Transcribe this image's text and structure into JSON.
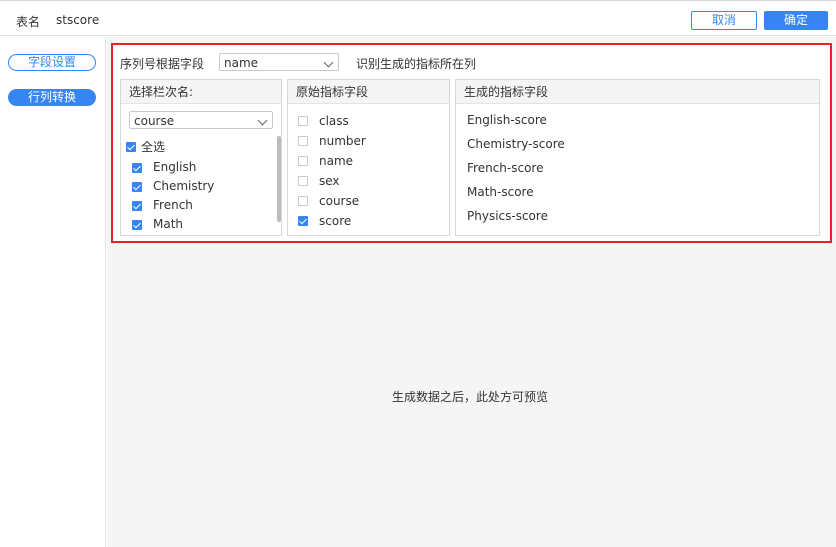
{
  "header": {
    "table_label": "表名",
    "table_name": "stscore",
    "cancel_label": "取消",
    "confirm_label": "确定"
  },
  "sidebar": {
    "field_settings_label": "字段设置",
    "row_col_transform_label": "行列转换"
  },
  "config": {
    "serial_label": "序列号根据字段",
    "serial_field": "name",
    "hint": "识别生成的指标所在列"
  },
  "columns": {
    "select_header": "选择栏次名:",
    "select_value": "course",
    "select_all_label": "全选",
    "courses": [
      {
        "label": "English",
        "checked": true
      },
      {
        "label": "Chemistry",
        "checked": true
      },
      {
        "label": "French",
        "checked": true
      },
      {
        "label": "Math",
        "checked": true
      }
    ],
    "original_header": "原始指标字段",
    "original_fields": [
      {
        "label": "class",
        "checked": false
      },
      {
        "label": "number",
        "checked": false
      },
      {
        "label": "name",
        "checked": false
      },
      {
        "label": "sex",
        "checked": false
      },
      {
        "label": "course",
        "checked": false
      },
      {
        "label": "score",
        "checked": true
      }
    ],
    "generated_header": "生成的指标字段",
    "generated_fields": [
      "English-score",
      "Chemistry-score",
      "French-score",
      "Math-score",
      "Physics-score"
    ]
  },
  "preview": {
    "message": "生成数据之后，此处方可预览"
  },
  "colors": {
    "accent": "#3685f2",
    "highlight_border": "#e8202a",
    "panel_bg": "#f5f5f5"
  }
}
